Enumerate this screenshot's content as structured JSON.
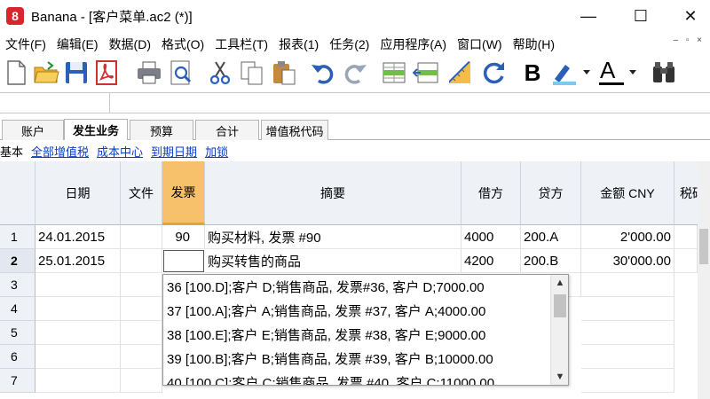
{
  "window": {
    "app_logo": "8",
    "title": "Banana - [客户菜单.ac2 (*)]",
    "minimize": "—",
    "maximize": "☐",
    "close": "✕"
  },
  "menu": {
    "items": [
      "文件(F)",
      "编辑(E)",
      "数据(D)",
      "格式(O)",
      "工具栏(T)",
      "报表(1)",
      "任务(2)",
      "应用程序(A)",
      "窗口(W)",
      "帮助(H)"
    ],
    "mdi_controls": "– ▫ ×"
  },
  "toolbar": {
    "icons": [
      "new-file-icon",
      "open-folder-icon",
      "save-icon",
      "pdf-icon",
      "print-icon",
      "print-preview-icon",
      "cut-icon",
      "copy-icon",
      "paste-icon",
      "undo-icon",
      "redo-icon",
      "insert-row-icon",
      "delete-row-icon",
      "ruler-icon",
      "refresh-icon",
      "bold-icon",
      "highlighter-icon",
      "font-color-icon",
      "binoculars-icon"
    ],
    "bold_label": "B",
    "font_color_label": "A",
    "accent_blue": "#2b5fb8",
    "pdf_red": "#d32f2f"
  },
  "input_line": {
    "cell_ref": "",
    "value": ""
  },
  "tabs": [
    "账户",
    "发生业务",
    "预算",
    "合计",
    "增值税代码"
  ],
  "active_tab": "发生业务",
  "views": {
    "current": "基本",
    "links": [
      "全部增值税",
      "成本中心",
      "到期日期",
      "加锁"
    ]
  },
  "table": {
    "columns": [
      "日期",
      "文件",
      "发票",
      "摘要",
      "借方",
      "贷方",
      "金额 CNY",
      "税码"
    ],
    "selected_column": "发票",
    "rows": [
      {
        "num": "1",
        "date": "24.01.2015",
        "doc": "",
        "invoice": "90",
        "desc": "购买材料, 发票 #90",
        "debit": "4000",
        "credit": "200.A",
        "amount": "2'000.00"
      },
      {
        "num": "2",
        "date": "25.01.2015",
        "doc": "",
        "invoice": "",
        "desc": "购买转售的商品",
        "debit": "4200",
        "credit": "200.B",
        "amount": "30'000.00"
      },
      {
        "num": "3"
      },
      {
        "num": "4"
      },
      {
        "num": "5"
      },
      {
        "num": "6"
      },
      {
        "num": "7"
      }
    ],
    "selected_row": "2"
  },
  "autocomplete": {
    "items": [
      "36  [100.D];客户 D;销售商品, 发票#36, 客户 D;7000.00",
      "37  [100.A];客户 A;销售商品, 发票 #37, 客户 A;4000.00",
      "38  [100.E];客户 E;销售商品, 发票 #38, 客户 E;9000.00",
      "39  [100.B];客户 B;销售商品, 发票 #39, 客户 B;10000.00",
      "40  [100.C];客户 C;销售商品, 发票 #40, 客户 C;11000.00"
    ],
    "up_arrow": "▲",
    "down_arrow": "▼"
  }
}
